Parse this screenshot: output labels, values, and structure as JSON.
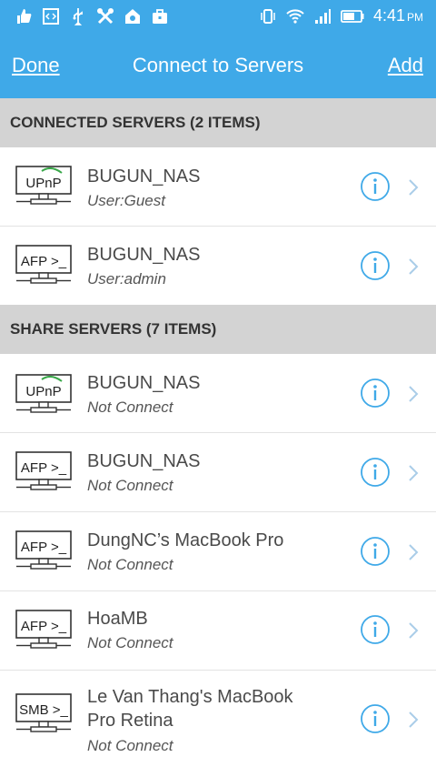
{
  "status_bar": {
    "time": "4:41",
    "ampm": "PM"
  },
  "nav": {
    "done_label": "Done",
    "title": "Connect to Servers",
    "add_label": "Add"
  },
  "sections": {
    "connected": {
      "header": "CONNECTED SERVERS (2 ITEMS)",
      "items": [
        {
          "protocol": "UPnP",
          "name": "BUGUN_NAS",
          "status": "User:Guest"
        },
        {
          "protocol": "AFP",
          "name": "BUGUN_NAS",
          "status": "User:admin"
        }
      ]
    },
    "share": {
      "header": "SHARE SERVERS (7 ITEMS)",
      "items": [
        {
          "protocol": "UPnP",
          "name": "BUGUN_NAS",
          "status": "Not Connect"
        },
        {
          "protocol": "AFP",
          "name": "BUGUN_NAS",
          "status": "Not Connect"
        },
        {
          "protocol": "AFP",
          "name": "DungNC’s MacBook Pro",
          "status": "Not Connect"
        },
        {
          "protocol": "AFP",
          "name": "HoaMB",
          "status": "Not Connect"
        },
        {
          "protocol": "SMB",
          "name_line1": "Le Van Thang's MacBook",
          "name_line2": "Pro Retina",
          "status": "Not Connect"
        }
      ]
    }
  },
  "icon_labels": {
    "upnp": "UPnP",
    "afp": "AFP >_",
    "smb": "SMB >_"
  },
  "colors": {
    "accent": "#3fa9e8",
    "section_bg": "#d3d3d3"
  }
}
